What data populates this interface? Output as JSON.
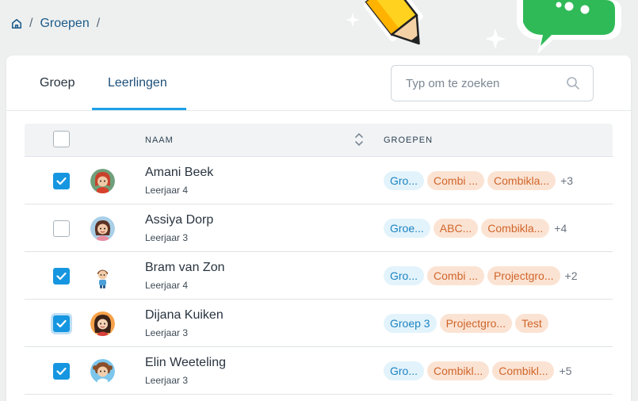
{
  "breadcrumb": {
    "home_icon": "home-icon",
    "link": "Groepen",
    "separator": "/"
  },
  "tabs": [
    {
      "label": "Groep",
      "active": false
    },
    {
      "label": "Leerlingen",
      "active": true
    }
  ],
  "search": {
    "placeholder": "Typ om te zoeken",
    "value": "",
    "icon": "search-icon"
  },
  "table": {
    "headers": {
      "name": "NAAM",
      "groups": "GROEPEN"
    },
    "rows": [
      {
        "name": "Amani Beek",
        "year": "Leerjaar 4",
        "checked": true,
        "tags": [
          {
            "label": "Gro...",
            "color": "blue"
          },
          {
            "label": "Combi ...",
            "color": "orange"
          },
          {
            "label": "Combikla...",
            "color": "orange"
          }
        ],
        "more": "+3"
      },
      {
        "name": "Assiya Dorp",
        "year": "Leerjaar 3",
        "checked": false,
        "tags": [
          {
            "label": "Groe...",
            "color": "blue"
          },
          {
            "label": "ABC...",
            "color": "orange"
          },
          {
            "label": "Combikla...",
            "color": "orange"
          }
        ],
        "more": "+4"
      },
      {
        "name": "Bram van Zon",
        "year": "Leerjaar 4",
        "checked": true,
        "tags": [
          {
            "label": "Gro...",
            "color": "blue"
          },
          {
            "label": "Combi ...",
            "color": "orange"
          },
          {
            "label": "Projectgro...",
            "color": "orange"
          }
        ],
        "more": "+2"
      },
      {
        "name": "Dijana Kuiken",
        "year": "Leerjaar 3",
        "checked": true,
        "tags": [
          {
            "label": "Groep 3",
            "color": "blue"
          },
          {
            "label": "Projectgro...",
            "color": "orange"
          },
          {
            "label": "Test",
            "color": "orange"
          }
        ],
        "more": ""
      },
      {
        "name": "Elin Weeteling",
        "year": "Leerjaar 3",
        "checked": true,
        "tags": [
          {
            "label": "Gro...",
            "color": "blue"
          },
          {
            "label": "Combikl...",
            "color": "orange"
          },
          {
            "label": "Combikl...",
            "color": "orange"
          }
        ],
        "more": "+5"
      }
    ]
  },
  "colors": {
    "accent": "#1ea1e8",
    "checkbox": "#1696e0",
    "tag_blue_bg": "#e3f3fb",
    "tag_orange_bg": "#fbe3d3"
  }
}
